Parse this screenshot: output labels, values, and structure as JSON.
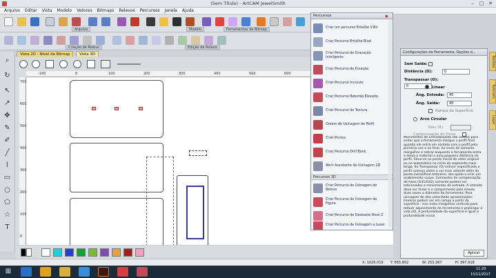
{
  "window": {
    "title": "(Sem Título) - ArtCAM JewelSmith",
    "controls": [
      "–",
      "□",
      "✕"
    ]
  },
  "menu": [
    "Arquivo",
    "Editar",
    "Vista",
    "Modelo",
    "Vetores",
    "Bitmaps",
    "Relevos",
    "Percursos",
    "Janela",
    "Ajuda"
  ],
  "toolbar_groups": {
    "arquivo": "Arquivo",
    "modelo": "Modelo",
    "ferramentas_bitmap": "Ferramentas de Bitmap",
    "criacao_relevo": "Criação de Relevo",
    "edicao_relevo": "Edição de Relevo"
  },
  "view_tabs": {
    "tab2d": "Vista 2D - Nível de Bitmap",
    "tab3d": "Vista 3D"
  },
  "ruler": {
    "top": [
      "-100",
      "0",
      "100",
      "200",
      "300",
      "400",
      "500",
      "600",
      "700",
      "800"
    ],
    "left": [
      "700",
      "600",
      "500",
      "400",
      "300",
      "200",
      "100",
      "0"
    ]
  },
  "percursos_panel": {
    "title": "Percursos",
    "items_2d": [
      {
        "label": "Criar um percurso Entalhe V-Bit",
        "color": "#7a8db5"
      },
      {
        "label": "Criar Percurso Entalhe Bisel",
        "color": "#9aa7c4"
      },
      {
        "label": "Criar Percurso de Gravação Inteligente",
        "color": "#8795b8"
      },
      {
        "label": "Criar Percurso de Puração",
        "color": "#c04c5a"
      },
      {
        "label": "Criar Percurso Incruste",
        "color": "#a55ab0"
      },
      {
        "label": "Criar Percurso Rebordo Elevado",
        "color": "#c54a55"
      },
      {
        "label": "Criar Percurso de Textura",
        "color": "#7d86a6"
      },
      {
        "label": "Ordem de Usinagem de Perfil",
        "color": "#b9474f"
      },
      {
        "label": "Criar Pontes",
        "color": "#c43d4d"
      },
      {
        "label": "Criar Percurso Drill Bank",
        "color": "#c0454d"
      },
      {
        "label": "Abrir Assistente de Usinagem 2D",
        "color": "#8a90aa"
      }
    ],
    "section_3d": "Percursos 3D",
    "items_3d": [
      {
        "label": "Criar Percurso de Usinagem de Relevo",
        "color": "#8b8fae"
      },
      {
        "label": "Criar Percurso de Usinagem de Figura",
        "color": "#c84c5c"
      },
      {
        "label": "Criar Percurso de Desbaste Nível Z",
        "color": "#d4708a"
      },
      {
        "label": "Criar Percurso de Usinagem a Laser",
        "color": "#c34b5a"
      }
    ]
  },
  "config_panel": {
    "title": "Configurações de Ferramenta: Opções d...",
    "sem_saida": "Sem Saída:",
    "distancia_label": "Distância (D):",
    "distancia_value": "0",
    "transpassar_label": "Transpassar (O):",
    "transpassar_value": "0",
    "linear": "Linear",
    "ang_entrada_label": "Âng. Entrada:",
    "ang_entrada_value": "45",
    "ang_saida_label": "Âng. Saída:",
    "ang_saida_value": "45",
    "rampa": "Rampa da Superfície",
    "arco_circular": "Arco Circular",
    "raio_label": "Raio (R):",
    "compensacao": "Compensação de fresa:",
    "help": "Movimentos de Entrada/Saída são usados para evitar que a ferramenta marque o perfil final quando ele entra em contato com o perfil pela primeira vez e no final. Ao invés de somente mergulhar e retirar enquanto a ferramenta entra e deixa o material a uma pequena distância do perfil. Situe-se no ponto inicial do vetor original ou no automático no início do segmento mais longo. Se Transpassar (O) estiver especificado o perfil começa antes e vai mais adiante além do ponto inicial/final ordinário; isto ajuda a criar um acabamento suave. Comandos de compensação de fresa (G41/G42) somente podem ser adicionados a movimentos de entrada. A entrada deve ser linear e o comprimento pelo menos duas vezes o diâmetro da ferramenta. Para usinagem de alta velocidade aproximações lineares podem ser em rampa a partir da superfície - isso evita mergulhos verticais para reduzir aquecimento da ferramenta e prolongar a vida útil. A profundidade da superfície é igual à profundidade inicial",
    "apply": "Aplicar"
  },
  "right_tabs": [
    "Toolbox",
    "Tutoriais",
    "Layer"
  ],
  "status": {
    "x": "X: 1026.019",
    "y": "Y: 655.802",
    "w": "W: 253.367",
    "h": "H: 397.918"
  },
  "clock": {
    "time": "11:20",
    "date": "15/11/2017"
  },
  "colors": {
    "accent_tab": "#f3d97a",
    "canvas": "#ffffff",
    "palette": [
      "#000000",
      "#ffffff",
      "#1fd0d8",
      "#1e40d8",
      "#1e9a3e",
      "#7db83a",
      "#7b4ea8",
      "#e0a63a",
      "#a02020",
      "#f0a0c0"
    ]
  }
}
